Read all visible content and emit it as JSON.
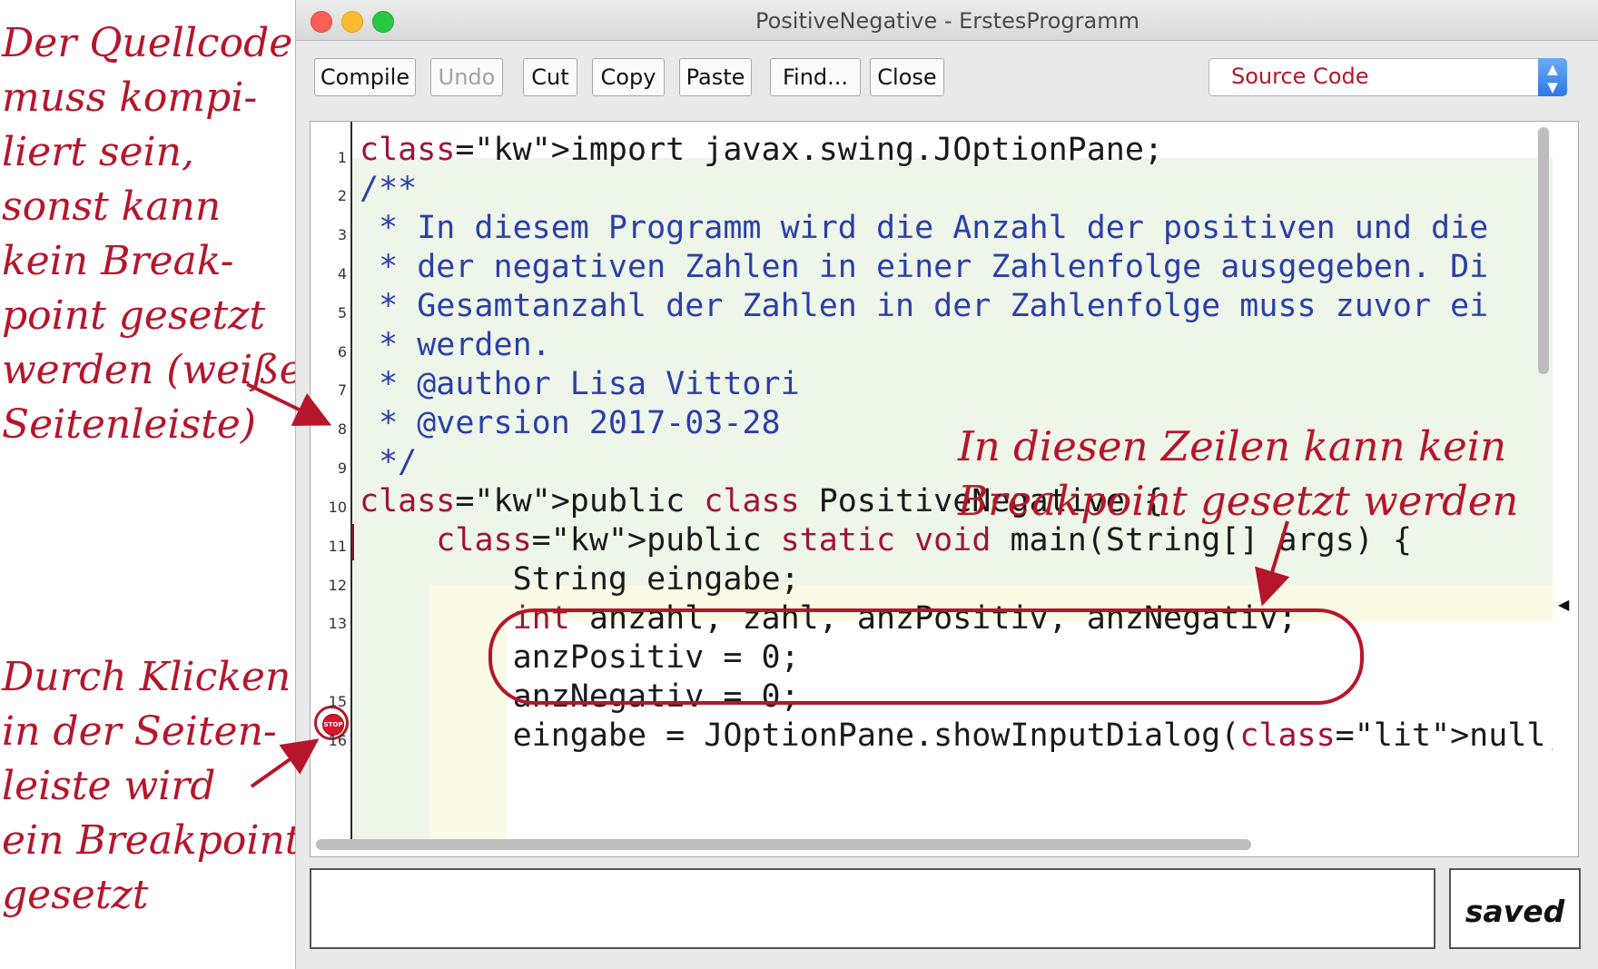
{
  "window": {
    "title": "PositiveNegative - ErstesProgramm"
  },
  "toolbar": {
    "compile": "Compile",
    "undo": "Undo",
    "cut": "Cut",
    "copy": "Copy",
    "paste": "Paste",
    "find": "Find...",
    "close": "Close"
  },
  "view_select": {
    "value": "Source Code"
  },
  "editor": {
    "line_numbers": [
      "1",
      "2",
      "3",
      "4",
      "5",
      "6",
      "7",
      "8",
      "9",
      "10",
      "11",
      "12",
      "13",
      "15",
      "16"
    ],
    "breakpoint_label": "STOP",
    "lines": [
      "import javax.swing.JOptionPane;",
      "/**",
      " * In diesem Programm wird die Anzahl der positiven und die",
      " * der negativen Zahlen in einer Zahlenfolge ausgegeben. Di",
      " * Gesamtanzahl der Zahlen in der Zahlenfolge muss zuvor ei",
      " * werden.",
      " * @author Lisa Vittori",
      " * @version 2017-03-28",
      " */",
      "public class PositiveNegative {",
      "    public static void main(String[] args) {",
      "        String eingabe;",
      "        int anzahl, zahl, anzPositiv, anzNegativ;",
      "        anzPositiv = 0;",
      "        anzNegativ = 0;",
      "        eingabe = JOptionPane.showInputDialog(null, \"Wie vi"
    ]
  },
  "status": {
    "text": "saved"
  },
  "annotations": {
    "left_top": "Der Quellcode\nmuss kompi-\nliert sein,\nsonst kann\nkein Break-\npoint gesetzt\nwerden (weiße\nSeitenleiste)",
    "left_bottom": "Durch Klicken\nin der Seiten-\nleiste wird\nein Breakpoint\ngesetzt",
    "center": "In diesen Zeilen kann kein\nBreakpoint gesetzt werden"
  },
  "colors": {
    "annotation": "#b5162b",
    "keyword": "#a0143a",
    "comment": "#2b3fa8"
  }
}
